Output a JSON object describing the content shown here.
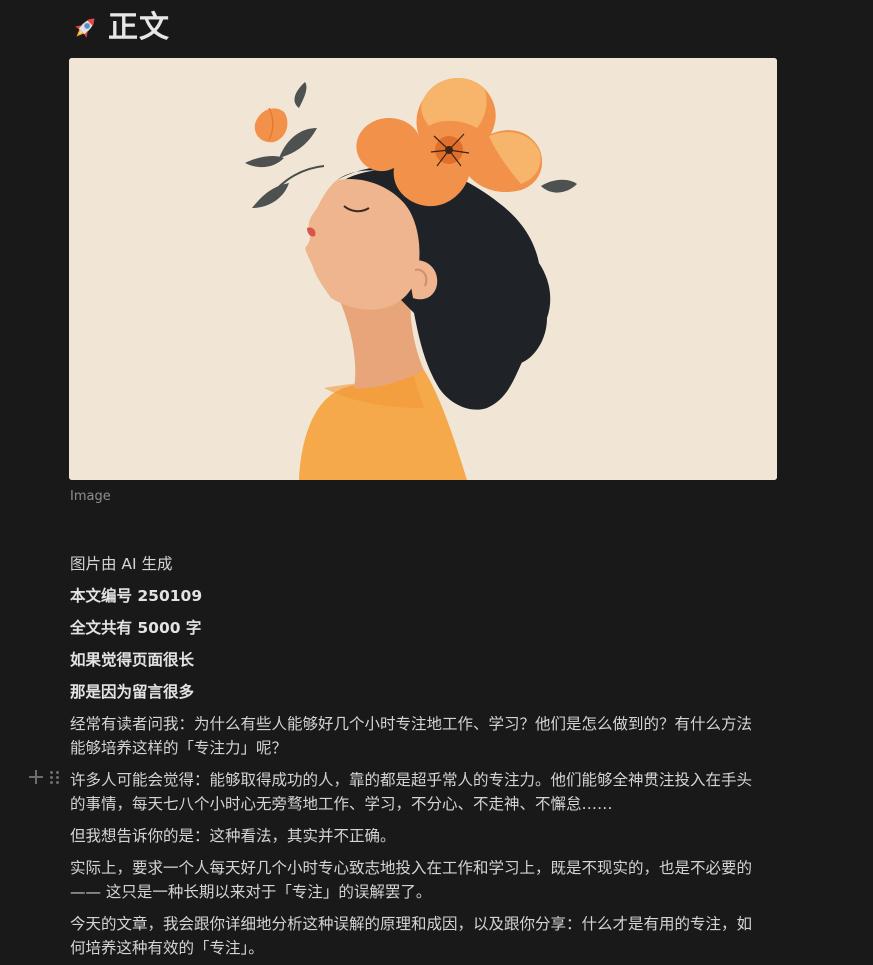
{
  "page": {
    "title": "正文",
    "title_icon": "rocket-icon"
  },
  "cover_image": {
    "caption": "Image"
  },
  "content": {
    "p1": "图片由 AI 生成",
    "p2": "本文编号 250109",
    "p3": "全文共有 5000 字",
    "p4": "如果觉得页面很长",
    "p5": "那是因为留言很多",
    "p6_line1": "经常有读者问我：为什么有些人能够好几个小时专注地工作、学习？他们是怎么做到的？有什么方法",
    "p6_line2": "能够培养这样的「专注力」呢？",
    "p7_line1": "许多人可能会觉得：能够取得成功的人，靠的都是超乎常人的专注力。他们能够全神贯注投入在手头",
    "p7_line2": "的事情，每天七八个小时心无旁骛地工作、学习，不分心、不走神、不懈怠……",
    "p8": "但我想告诉你的是：这种看法，其实并不正确。",
    "p9_line1": "实际上，要求一个人每天好几个小时专心致志地投入在工作和学习上，既是不现实的，也是不必要的",
    "p9_line2": "—— 这只是一种长期以来对于「专注」的误解罢了。",
    "p10_line1": "今天的文章，我会跟你详细地分析这种误解的原理和成因，以及跟你分享：什么才是有用的专注，如",
    "p10_line2": "何培养这种有效的「专注」。"
  },
  "colors": {
    "background": "#191919",
    "text": "#d4d4d4",
    "muted": "#8e8e8e",
    "cover_bg": "#f1e6d6",
    "flower": "#f2914a",
    "hair": "#1f2328",
    "shirt": "#f5a94a"
  },
  "icons": {
    "add_block": "plus-icon",
    "drag_handle": "drag-handle-icon"
  }
}
